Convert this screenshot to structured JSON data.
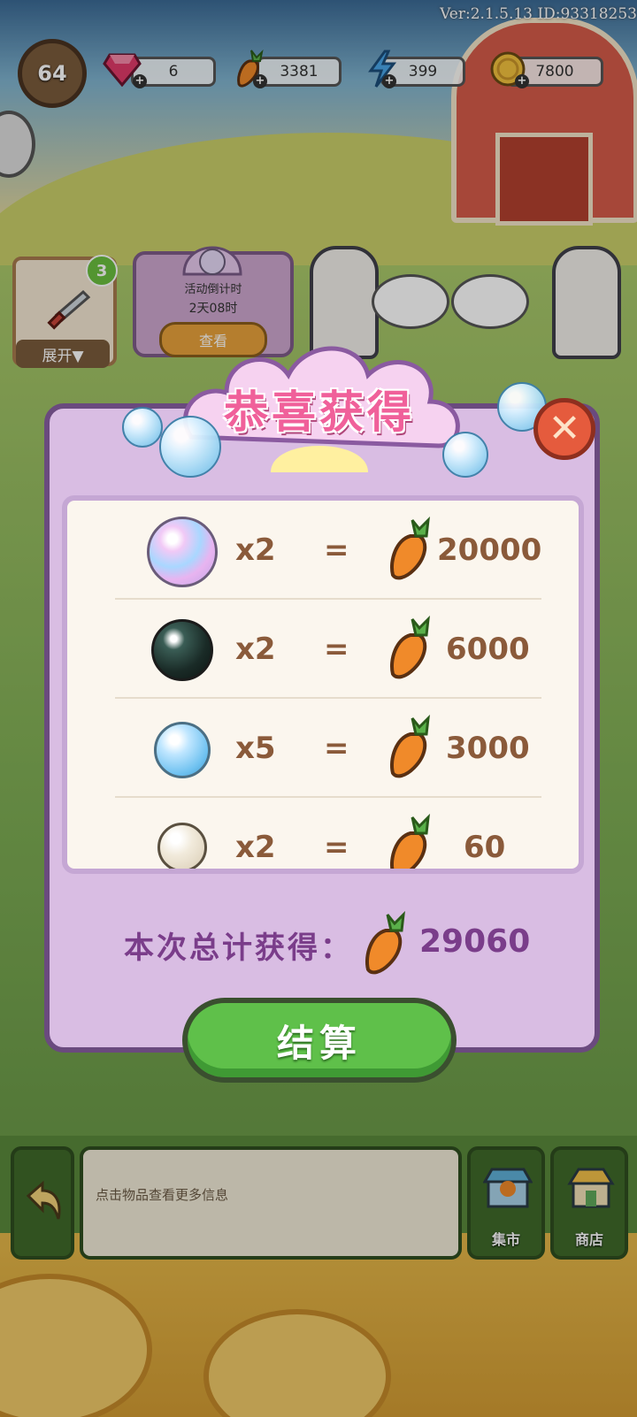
{
  "version_text": "Ver:2.1.5.13 ID:93318253",
  "player": {
    "level": "64"
  },
  "resources": [
    {
      "name": "gem",
      "icon": "gem-icon",
      "value": "6"
    },
    {
      "name": "carrot",
      "icon": "carrot-icon",
      "value": "3381"
    },
    {
      "name": "energy",
      "icon": "lightning-icon",
      "value": "399"
    },
    {
      "name": "coin",
      "icon": "coin-icon",
      "value": "7800"
    }
  ],
  "item_panel": {
    "badge": "3",
    "expand_label": "展开▼"
  },
  "event_panel": {
    "title": "活动倒计时",
    "time": "2天08时",
    "button": "查看"
  },
  "dialog": {
    "title": "恭喜获得",
    "rows": [
      {
        "item": "rainbow-pearl",
        "qty": "x2",
        "eq": "=",
        "value": "20000"
      },
      {
        "item": "black-pearl",
        "qty": "x2",
        "eq": "=",
        "value": "6000"
      },
      {
        "item": "blue-pearl",
        "qty": "x5",
        "eq": "=",
        "value": "3000"
      },
      {
        "item": "white-pearl",
        "qty": "x2",
        "eq": "=",
        "value": "60"
      }
    ],
    "total_label": "本次总计获得：",
    "total_value": "29060",
    "settle_button": "结算"
  },
  "bottom": {
    "info_text": "点击物品查看更多信息",
    "market_label": "集市",
    "shop_label": "商店"
  },
  "colors": {
    "dialog_bg": "#d9bde3",
    "accent": "#f0609a",
    "button_green": "#5fc04a",
    "text_brown": "#8a5a3a",
    "total_purple": "#7a3d8a"
  }
}
